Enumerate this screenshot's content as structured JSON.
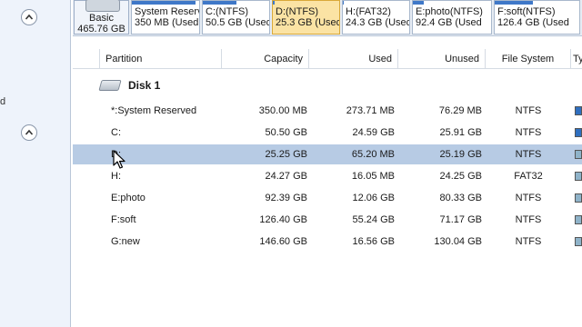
{
  "sidebar": {
    "text": "d"
  },
  "disk_map": {
    "disk_line1": "Basic",
    "disk_line2": "465.76 GB",
    "partitions": [
      {
        "name": "System Reserv",
        "size": "350 MB (Used:"
      },
      {
        "name": "C:(NTFS)",
        "size": "50.5 GB (Used"
      },
      {
        "name": "D:(NTFS)",
        "size": "25.3 GB (Used"
      },
      {
        "name": "H:(FAT32)",
        "size": "24.3 GB (Used"
      },
      {
        "name": "E:photo(NTFS)",
        "size": "92.4 GB (Used"
      },
      {
        "name": "F:soft(NTFS)",
        "size": "126.4 GB (Used"
      }
    ]
  },
  "table": {
    "headers": [
      "Partition",
      "Capacity",
      "Used",
      "Unused",
      "File System",
      "Ty"
    ],
    "disk_label": "Disk 1",
    "rows": [
      {
        "partition": "*:System Reserved",
        "capacity": "350.00 MB",
        "used": "273.71 MB",
        "unused": "76.29 MB",
        "fs": "NTFS"
      },
      {
        "partition": "C:",
        "capacity": "50.50 GB",
        "used": "24.59 GB",
        "unused": "25.91 GB",
        "fs": "NTFS"
      },
      {
        "partition": "D:",
        "capacity": "25.25 GB",
        "used": "65.20 MB",
        "unused": "25.19 GB",
        "fs": "NTFS"
      },
      {
        "partition": "H:",
        "capacity": "24.27 GB",
        "used": "16.05 MB",
        "unused": "24.25 GB",
        "fs": "FAT32"
      },
      {
        "partition": "E:photo",
        "capacity": "92.39 GB",
        "used": "12.06 GB",
        "unused": "80.33 GB",
        "fs": "NTFS"
      },
      {
        "partition": "F:soft",
        "capacity": "126.40 GB",
        "used": "55.24 GB",
        "unused": "71.17 GB",
        "fs": "NTFS"
      },
      {
        "partition": "G:new",
        "capacity": "146.60 GB",
        "used": "16.56 GB",
        "unused": "130.04 GB",
        "fs": "NTFS"
      }
    ]
  },
  "colors": {
    "selected_row": "#b7cbe4",
    "selected_partition": "#fbe3a4",
    "partition_bar": "#3f78c8",
    "type_swatch_primary": "#2f6fbf",
    "type_swatch_logical": "#8fb3c9"
  }
}
